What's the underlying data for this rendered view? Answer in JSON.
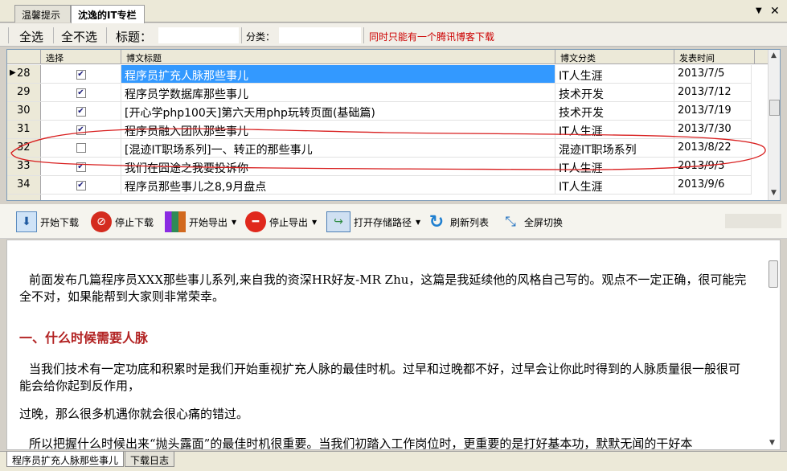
{
  "tabs": {
    "tips": "温馨提示",
    "blog": "沈逸的IT专栏",
    "pin": "▼",
    "close": "✕"
  },
  "filter": {
    "select_all": "全选",
    "select_none": "全不选",
    "title_label": "标题：",
    "title_value": "",
    "category_label": "分类：",
    "category_value": "",
    "notice": "同时只能有一个腾讯博客下载"
  },
  "grid": {
    "headers": {
      "select": "选择",
      "title": "博文标题",
      "category": "博文分类",
      "date": "发表时间"
    },
    "rows": [
      {
        "num": "28",
        "checked": true,
        "title": "程序员扩充人脉那些事儿",
        "category": "IT人生涯",
        "date": "2013/7/5"
      },
      {
        "num": "29",
        "checked": true,
        "title": "程序员学数据库那些事儿",
        "category": "技术开发",
        "date": "2013/7/12"
      },
      {
        "num": "30",
        "checked": true,
        "title": "[开心学php100天]第六天用php玩转页面(基础篇)",
        "category": "技术开发",
        "date": "2013/7/19"
      },
      {
        "num": "31",
        "checked": true,
        "title": "程序员融入团队那些事儿",
        "category": "IT人生涯",
        "date": "2013/7/30"
      },
      {
        "num": "32",
        "checked": false,
        "title": "[混迹IT职场系列]一、转正的那些事儿",
        "category": "混迹IT职场系列",
        "date": "2013/8/22"
      },
      {
        "num": "33",
        "checked": true,
        "title": "我们在囧途之我要投诉你",
        "category": "IT人生涯",
        "date": "2013/9/3"
      },
      {
        "num": "34",
        "checked": true,
        "title": "程序员那些事儿之8,9月盘点",
        "category": "IT人生涯",
        "date": "2013/9/6"
      }
    ]
  },
  "toolbar": {
    "start_download": "开始下载",
    "stop_download": "停止下载",
    "start_export": "开始导出",
    "stop_export": "停止导出",
    "open_path": "打开存储路径",
    "refresh": "刷新列表",
    "fullscreen": "全屏切换"
  },
  "article": {
    "p1": "前面发布几篇程序员XXX那些事儿系列,来自我的资深HR好友-MR Zhu，这篇是我延续他的风格自己写的。观点不一定正确，很可能完全不对，如果能帮到大家则非常荣幸。",
    "heading1": "一、什么时候需要人脉",
    "p2": "当我们技术有一定功底和积累时是我们开始重视扩充人脉的最佳时机。过早和过晚都不好，过早会让你此时得到的人脉质量很一般很可能会给你起到反作用，",
    "p3": "过晚，那么很多机遇你就会很心痛的错过。",
    "p4": "所以把握什么时候出来“抛头露面”的最佳时机很重要。当我们初踏入工作岗位时，更重要的是打好基本功，默默无闻的干好本"
  },
  "bottom_tabs": {
    "article": "程序员扩充人脉那些事儿",
    "log": "下载日志"
  },
  "colors": {
    "selection": "#3399ff",
    "heading": "#b22222",
    "notice": "#cc0000",
    "annotation": "#d81e1e"
  }
}
